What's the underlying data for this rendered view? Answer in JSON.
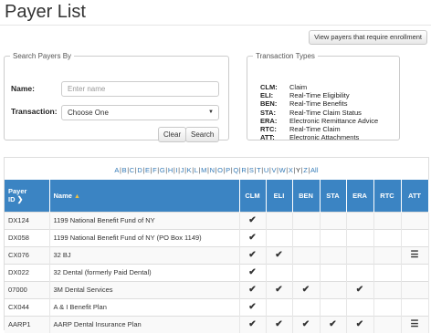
{
  "page": {
    "title": "Payer List",
    "view_button": "View payers that require enrollment"
  },
  "search": {
    "legend": "Search Payers By",
    "name_label": "Name:",
    "name_placeholder": "Enter name",
    "transaction_label": "Transaction:",
    "transaction_value": "Choose One",
    "clear_button": "Clear",
    "search_button": "Search"
  },
  "transaction_types": {
    "legend": "Transaction Types",
    "items": [
      {
        "code": "CLM:",
        "desc": "Claim"
      },
      {
        "code": "ELI:",
        "desc": "Real-Time Eligibility"
      },
      {
        "code": "BEN:",
        "desc": "Real-Time Benefits"
      },
      {
        "code": "STA:",
        "desc": "Real-Time Claim Status"
      },
      {
        "code": "ERA:",
        "desc": "Electronic Remittance Advice"
      },
      {
        "code": "RTC:",
        "desc": "Real-Time Claim"
      },
      {
        "code": "ATT:",
        "desc": "Electronic Attachments"
      }
    ]
  },
  "alphabet": [
    "A",
    "B",
    "C",
    "D",
    "E",
    "F",
    "G",
    "H",
    "I",
    "J",
    "K",
    "L",
    "M",
    "N",
    "O",
    "P",
    "Q",
    "R",
    "S",
    "T",
    "U",
    "V",
    "W",
    "X",
    "Y",
    "Z",
    "All"
  ],
  "current_letter": "Y",
  "table": {
    "headers": {
      "payer_id_1": "Payer",
      "payer_id_2": "ID",
      "name": "Name",
      "clm": "CLM",
      "eli": "ELI",
      "ben": "BEN",
      "sta": "STA",
      "era": "ERA",
      "rtc": "RTC",
      "att": "ATT"
    },
    "rows": [
      {
        "id": "DX124",
        "name": "1199 National Benefit Fund of NY",
        "clm": true,
        "eli": false,
        "ben": false,
        "sta": false,
        "era": false,
        "rtc": false,
        "att": false
      },
      {
        "id": "DX058",
        "name": "1199 National Benefit Fund of NY (PO Box 1149)",
        "clm": true,
        "eli": false,
        "ben": false,
        "sta": false,
        "era": false,
        "rtc": false,
        "att": false
      },
      {
        "id": "CX076",
        "name": "32 BJ",
        "clm": true,
        "eli": true,
        "ben": false,
        "sta": false,
        "era": false,
        "rtc": false,
        "att": true
      },
      {
        "id": "DX022",
        "name": "32 Dental (formerly Paid Dental)",
        "clm": true,
        "eli": false,
        "ben": false,
        "sta": false,
        "era": false,
        "rtc": false,
        "att": false
      },
      {
        "id": "07000",
        "name": "3M Dental Services",
        "clm": true,
        "eli": true,
        "ben": true,
        "sta": false,
        "era": true,
        "rtc": false,
        "att": false
      },
      {
        "id": "CX044",
        "name": "A & I Benefit Plan",
        "clm": true,
        "eli": false,
        "ben": false,
        "sta": false,
        "era": false,
        "rtc": false,
        "att": false
      },
      {
        "id": "AARP1",
        "name": "AARP Dental Insurance Plan",
        "clm": true,
        "eli": true,
        "ben": true,
        "sta": true,
        "era": true,
        "rtc": false,
        "att": true
      }
    ]
  },
  "icons": {
    "check": "check-icon",
    "attachment": "list-icon",
    "sort": "sort-asc-icon",
    "chevron": "chevron-right-icon"
  },
  "colors": {
    "header_bg": "#3b84c3",
    "link": "#337ab7",
    "sort_arrow": "#f0c040"
  }
}
